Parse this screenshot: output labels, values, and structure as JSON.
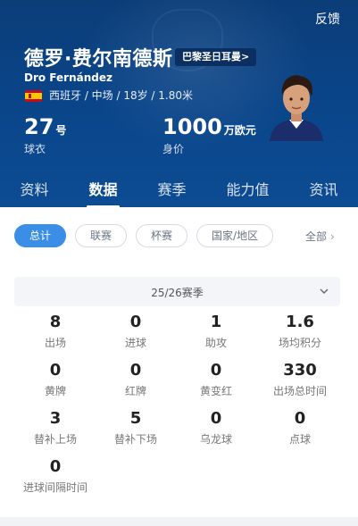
{
  "header": {
    "feedback": "反馈",
    "player_name": "德罗·费尔南德斯",
    "team_tag": "巴黎圣日耳曼>",
    "latin_name": "Dro Fernández",
    "info_line": "西班牙 / 中场 / 18岁 / 1.80米",
    "jersey_number": "27",
    "jersey_unit": "号",
    "jersey_caption": "球衣",
    "market_value": "1000",
    "market_value_unit": "万欧元",
    "market_value_caption": "身价"
  },
  "tabs": [
    {
      "label": "资料",
      "active": false
    },
    {
      "label": "数据",
      "active": true
    },
    {
      "label": "赛季",
      "active": false
    },
    {
      "label": "能力值",
      "active": false
    },
    {
      "label": "资讯",
      "active": false
    }
  ],
  "filters": [
    {
      "label": "总计",
      "active": true
    },
    {
      "label": "联赛",
      "active": false
    },
    {
      "label": "杯赛",
      "active": false
    },
    {
      "label": "国家/地区",
      "active": false
    }
  ],
  "filter_all": "全部",
  "season": "25/26赛季",
  "stats": [
    {
      "value": "8",
      "label": "出场"
    },
    {
      "value": "0",
      "label": "进球"
    },
    {
      "value": "1",
      "label": "助攻"
    },
    {
      "value": "1.6",
      "label": "场均积分"
    },
    {
      "value": "0",
      "label": "黄牌"
    },
    {
      "value": "0",
      "label": "红牌"
    },
    {
      "value": "0",
      "label": "黄变红"
    },
    {
      "value": "330",
      "label": "出场总时间"
    },
    {
      "value": "3",
      "label": "替补上场"
    },
    {
      "value": "5",
      "label": "替补下场"
    },
    {
      "value": "0",
      "label": "乌龙球"
    },
    {
      "value": "0",
      "label": "点球"
    },
    {
      "value": "0",
      "label": "进球间隔时间"
    }
  ],
  "colors": {
    "header_bg": "#0a4488",
    "accent": "#3a8ee6"
  }
}
